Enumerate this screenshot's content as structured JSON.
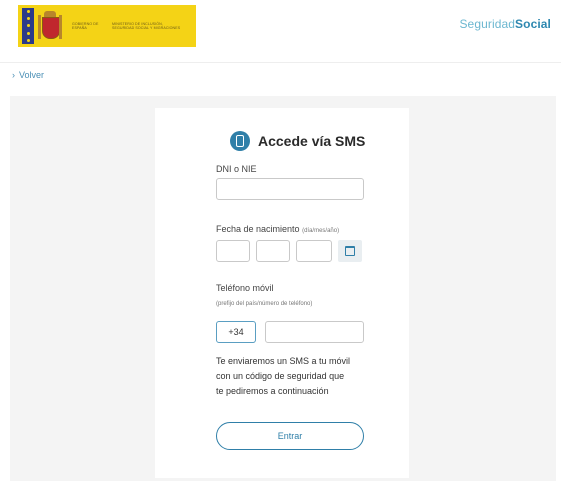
{
  "header": {
    "gov_line1": "Gobierno de España",
    "gov_line2": "Ministerio de Inclusión, Seguridad Social y Migraciones",
    "brand_light": "Seguridad",
    "brand_bold": "Social"
  },
  "nav": {
    "back_label": "Volver"
  },
  "form": {
    "title": "Accede vía SMS",
    "dni_label": "DNI o NIE",
    "dni_value": "",
    "birth_label": "Fecha de nacimiento",
    "birth_hint": "(día/mes/año)",
    "birth_day": "",
    "birth_month": "",
    "birth_year": "",
    "phone_label": "Teléfono móvil",
    "phone_hint": "(prefijo del país/número de teléfono)",
    "phone_prefix": "+34",
    "phone_value": "",
    "info_line1": "Te enviaremos un SMS a tu móvil",
    "info_line2": "con un código de seguridad que",
    "info_line3": "te pediremos a continuación",
    "submit_label": "Entrar"
  },
  "colors": {
    "accent": "#2f7fa8",
    "banner": "#f4d316",
    "panel": "#f4f4f4"
  }
}
